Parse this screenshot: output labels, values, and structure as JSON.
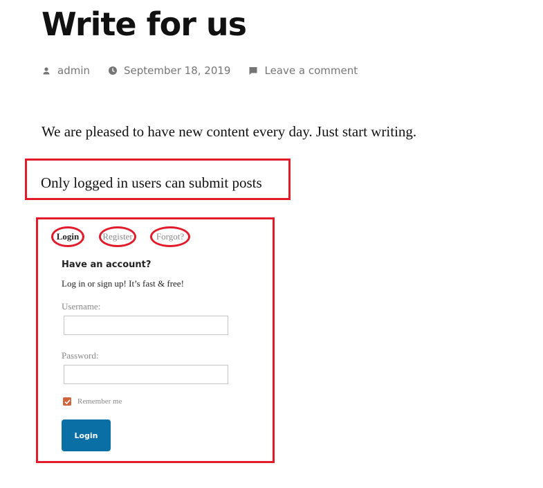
{
  "post": {
    "title": "Write for us",
    "meta": {
      "author": "admin",
      "author_icon": "person-icon",
      "date": "September 18, 2019",
      "date_icon": "clock-icon",
      "comments": "Leave a comment",
      "comments_icon": "comment-icon"
    },
    "intro": "We are pleased to have new content every day. Just start writing.",
    "notice": "Only logged in users can submit posts"
  },
  "login_widget": {
    "tabs": [
      {
        "label": "Login",
        "active": true
      },
      {
        "label": "Register",
        "active": false
      },
      {
        "label": "Forgot?",
        "active": false
      }
    ],
    "heading": "Have an account?",
    "subheading": "Log in or sign up! It’s fast & free!",
    "username_label": "Username:",
    "username_value": "",
    "password_label": "Password:",
    "password_value": "",
    "remember_label": "Remember me",
    "remember_checked": true,
    "submit_label": "Login"
  },
  "colors": {
    "highlight_red": "#e21b2b",
    "button_blue": "#0a6fa5",
    "checkbox_orange": "#d0643c",
    "meta_gray": "#767676"
  }
}
